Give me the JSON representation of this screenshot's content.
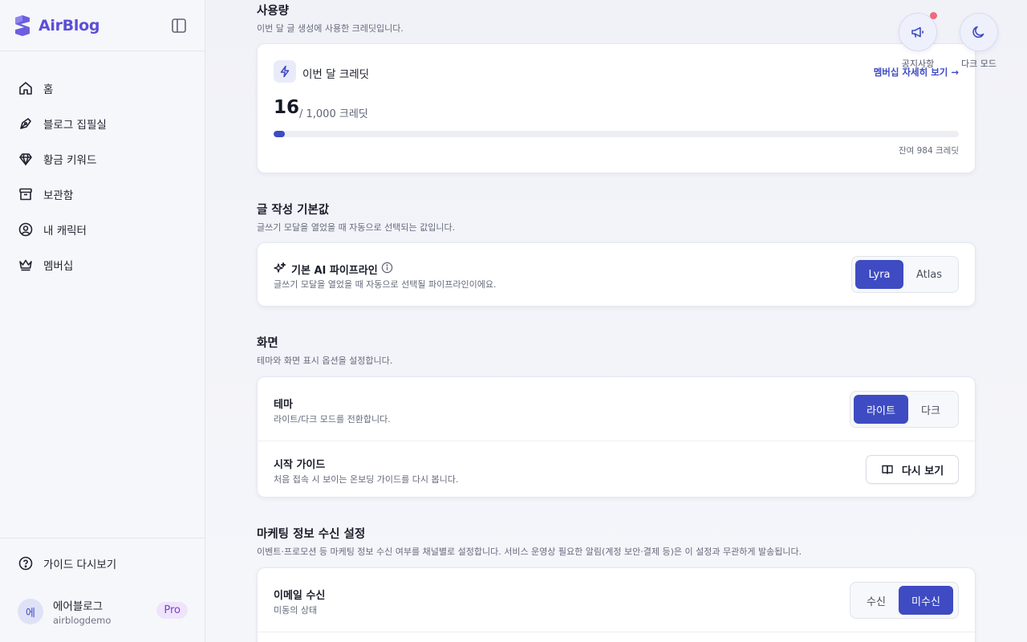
{
  "brand": {
    "name": "AirBlog"
  },
  "sidebar": {
    "items": [
      {
        "label": "홈",
        "icon": "home-icon"
      },
      {
        "label": "블로그 집필실",
        "icon": "pen-nib-icon"
      },
      {
        "label": "황금 키워드",
        "icon": "gem-icon"
      },
      {
        "label": "보관함",
        "icon": "archive-icon"
      },
      {
        "label": "내 캐릭터",
        "icon": "user-circle-icon"
      },
      {
        "label": "멤버십",
        "icon": "crown-icon"
      }
    ],
    "guide": "가이드 다시보기",
    "user": {
      "avatar": "에",
      "name": "에어블로그",
      "id": "airblogdemo",
      "plan": "Pro"
    }
  },
  "usage": {
    "title": "사용량",
    "desc": "이번 달 글 생성에 사용한 크레딧입니다.",
    "card_title": "이번 달 크레딧",
    "link": "멤버십 자세히 보기 →",
    "used": "16",
    "total": "/ 1,000 크레딧",
    "progress": 0.016,
    "remaining": "잔여 984 크레딧"
  },
  "defaults": {
    "title": "글 작성 기본값",
    "desc": "글쓰기 모달을 열었을 때 자동으로 선택되는 값입니다.",
    "pipeline_label": "기본 AI 파이프라인",
    "pipeline_desc": "글쓰기 모달을 열었을 때 자동으로 선택될 파이프라인이에요.",
    "options": [
      "Lyra",
      "Atlas"
    ],
    "selected": "Lyra"
  },
  "display": {
    "title": "화면",
    "desc": "테마와 화면 표시 옵션을 설정합니다.",
    "theme_label": "테마",
    "theme_desc": "라이트/다크 모드를 전환합니다.",
    "theme_options": [
      "라이트",
      "다크"
    ],
    "theme_selected": "라이트",
    "guide_label": "시작 가이드",
    "guide_desc": "처음 접속 시 보이는 온보딩 가이드를 다시 봅니다.",
    "guide_button": "다시 보기"
  },
  "marketing": {
    "title": "마케팅 정보 수신 설정",
    "desc": "이벤트·프로모션 등 마케팅 정보 수신 여부를 채널별로 설정합니다. 서비스 운영상 필요한 알림(계정 보안·결제 등)은 이 설정과 무관하게 발송됩니다.",
    "email_label": "이메일 수신",
    "email_desc": "미동의 상태",
    "email_options": [
      "수신",
      "미수신"
    ],
    "email_selected": "미수신"
  },
  "floating": {
    "notice": "공지사항",
    "darkmode": "다크 모드"
  },
  "colors": {
    "accent": "#3e4bc2",
    "brand": "#5b4fd6",
    "pro": "#7a3fcf"
  }
}
